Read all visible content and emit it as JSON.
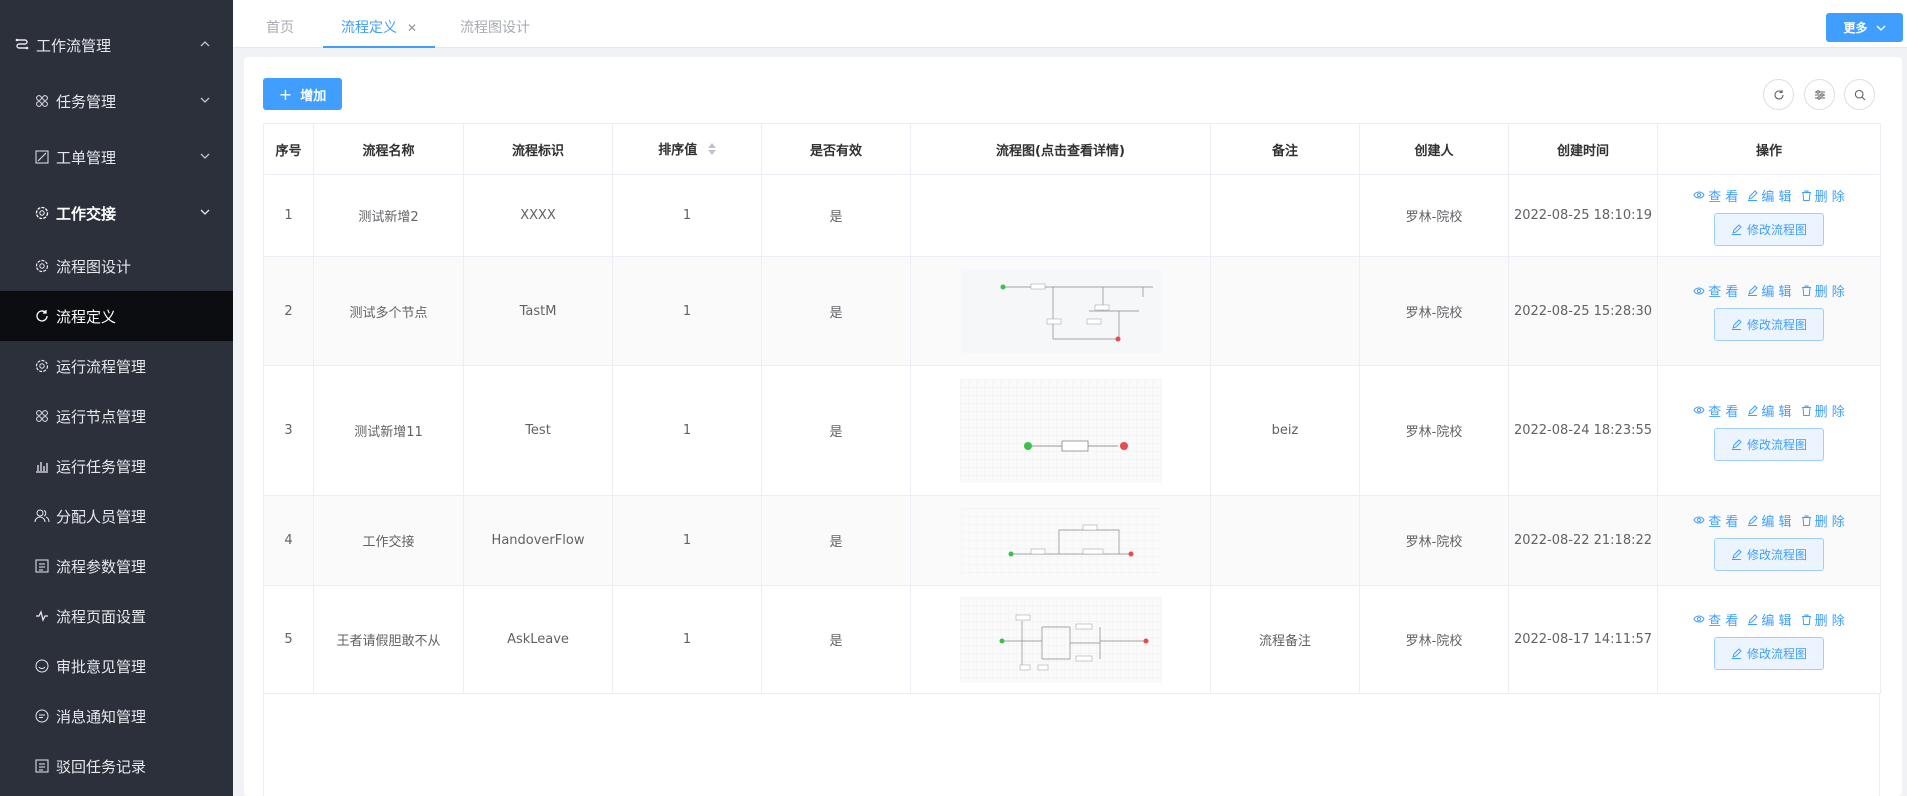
{
  "sidebar": {
    "items": [
      {
        "label": "工作流管理",
        "level": "top",
        "icon": "flow-icon"
      },
      {
        "label": "任务管理",
        "level": "sub",
        "icon": "grid-icon"
      },
      {
        "label": "工单管理",
        "level": "sub",
        "icon": "ticket-icon"
      },
      {
        "label": "工作交接",
        "level": "sub",
        "icon": "gear-icon"
      },
      {
        "label": "流程图设计",
        "level": "child",
        "icon": "gear-icon"
      },
      {
        "label": "流程定义",
        "level": "child",
        "icon": "refresh-icon"
      },
      {
        "label": "运行流程管理",
        "level": "child",
        "icon": "gear-icon"
      },
      {
        "label": "运行节点管理",
        "level": "child",
        "icon": "grid-icon"
      },
      {
        "label": "运行任务管理",
        "level": "child",
        "icon": "bar-chart-icon"
      },
      {
        "label": "分配人员管理",
        "level": "child",
        "icon": "users-icon"
      },
      {
        "label": "流程参数管理",
        "level": "child",
        "icon": "doc-icon"
      },
      {
        "label": "流程页面设置",
        "level": "child",
        "icon": "pulse-icon"
      },
      {
        "label": "审批意见管理",
        "level": "child",
        "icon": "smile-icon"
      },
      {
        "label": "消息通知管理",
        "level": "child",
        "icon": "chat-icon"
      },
      {
        "label": "驳回任务记录",
        "level": "child",
        "icon": "doc-icon"
      }
    ]
  },
  "tabs": [
    {
      "label": "首页"
    },
    {
      "label": "流程定义"
    },
    {
      "label": "流程图设计"
    }
  ],
  "more_label": "更多",
  "add_label": "增加",
  "table": {
    "headers": [
      "序号",
      "流程名称",
      "流程标识",
      "排序值",
      "是否有效",
      "流程图(点击查看详情)",
      "备注",
      "创建人",
      "创建时间",
      "操作"
    ],
    "rows": [
      {
        "no": "1",
        "name": "测试新增2",
        "key": "XXXX",
        "sort": "1",
        "valid": "是",
        "remark": "",
        "creator": "罗林-院校",
        "time": "2022-08-25 18:10:19"
      },
      {
        "no": "2",
        "name": "测试多个节点",
        "key": "TastM",
        "sort": "1",
        "valid": "是",
        "remark": "",
        "creator": "罗林-院校",
        "time": "2022-08-25 15:28:30"
      },
      {
        "no": "3",
        "name": "测试新增11",
        "key": "Test",
        "sort": "1",
        "valid": "是",
        "remark": "beiz",
        "creator": "罗林-院校",
        "time": "2022-08-24 18:23:55"
      },
      {
        "no": "4",
        "name": "工作交接",
        "key": "HandoverFlow",
        "sort": "1",
        "valid": "是",
        "remark": "",
        "creator": "罗林-院校",
        "time": "2022-08-22 21:18:22"
      },
      {
        "no": "5",
        "name": "王者请假胆敢不从",
        "key": "AskLeave",
        "sort": "1",
        "valid": "是",
        "remark": "流程备注",
        "creator": "罗林-院校",
        "time": "2022-08-17 14:11:57"
      }
    ]
  },
  "ops": {
    "view": "查 看",
    "edit": "编 辑",
    "delete": "删 除",
    "edit_flow": "修改流程图"
  },
  "colors": {
    "sidebar_bg": "#2b303b",
    "active_bg": "#0b0d10",
    "primary": "#409eff"
  }
}
